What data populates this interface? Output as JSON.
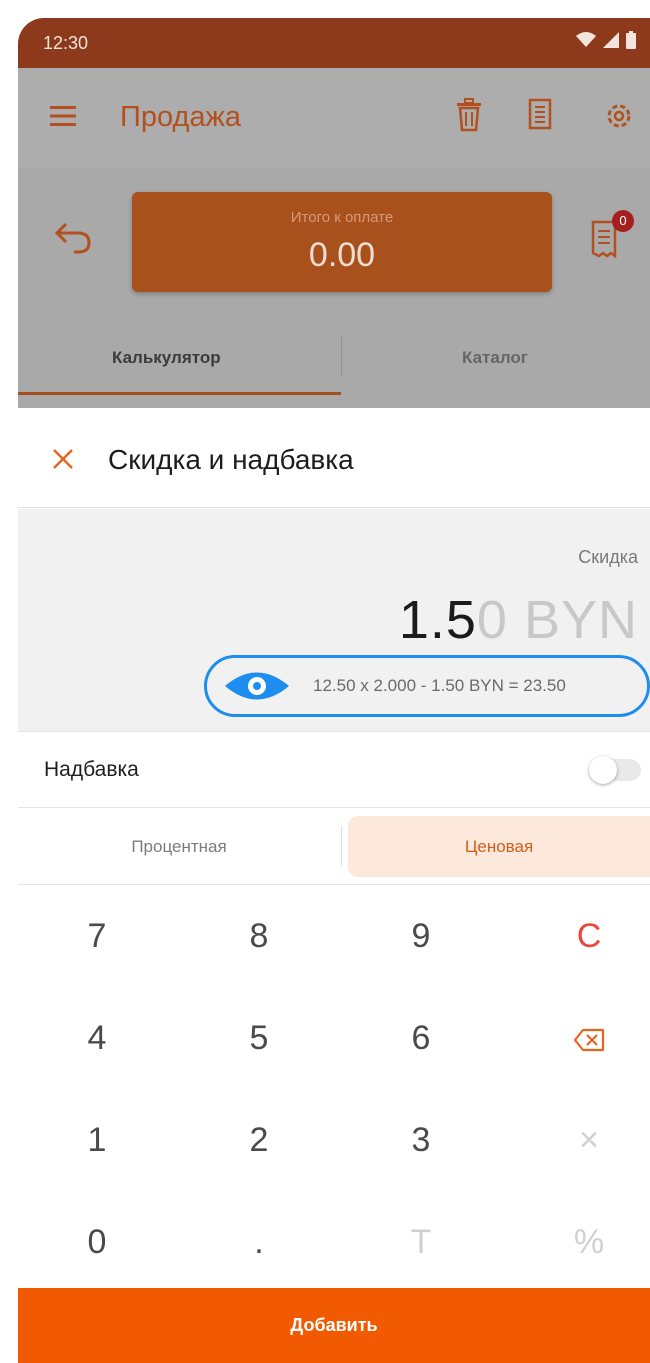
{
  "status_bar": {
    "time": "12:30"
  },
  "app_bar": {
    "title": "Продажа"
  },
  "total": {
    "label": "Итого к оплате",
    "value": "0.00",
    "receipt_badge": "0"
  },
  "tabs": [
    {
      "label": "Калькулятор",
      "active": true
    },
    {
      "label": "Каталог",
      "active": false
    }
  ],
  "sheet": {
    "title": "Скидка и надбавка",
    "display": {
      "type_label": "Скидка",
      "amount_typed": "1.5",
      "amount_ghost": "0 BYN",
      "formula": "12.50 x 2.000 - 1.50 BYN = 23.50"
    },
    "markup_toggle": {
      "label": "Надбавка",
      "on": false
    },
    "mode": {
      "options": [
        "Процентная",
        "Ценовая"
      ],
      "selected": "Ценовая"
    },
    "keypad": {
      "rows": [
        [
          "7",
          "8",
          "9",
          "C"
        ],
        [
          "4",
          "5",
          "6",
          "backspace-icon"
        ],
        [
          "1",
          "2",
          "3",
          "×"
        ],
        [
          "0",
          ".",
          "T",
          "%"
        ]
      ]
    },
    "add_button": "Добавить"
  },
  "colors": {
    "accent": "#f25a02",
    "highlight": "#1d8df0",
    "selected_bg": "#fde8dc",
    "clear": "#e8473b"
  }
}
